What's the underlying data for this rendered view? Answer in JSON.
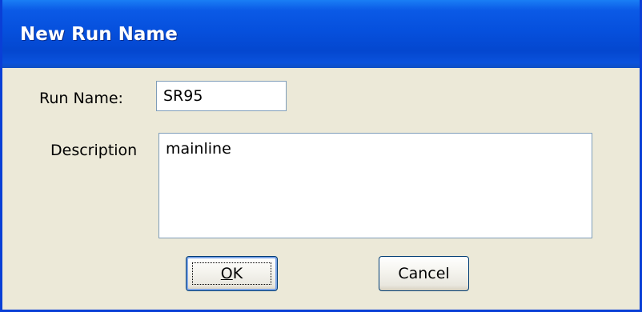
{
  "window": {
    "title": "New Run Name"
  },
  "form": {
    "run_name_label": "Run Name:",
    "run_name_value": "SR95",
    "description_label": "Description",
    "description_value": "mainline"
  },
  "buttons": {
    "ok_mnemonic": "O",
    "ok_rest": "K",
    "cancel_label": "Cancel"
  }
}
